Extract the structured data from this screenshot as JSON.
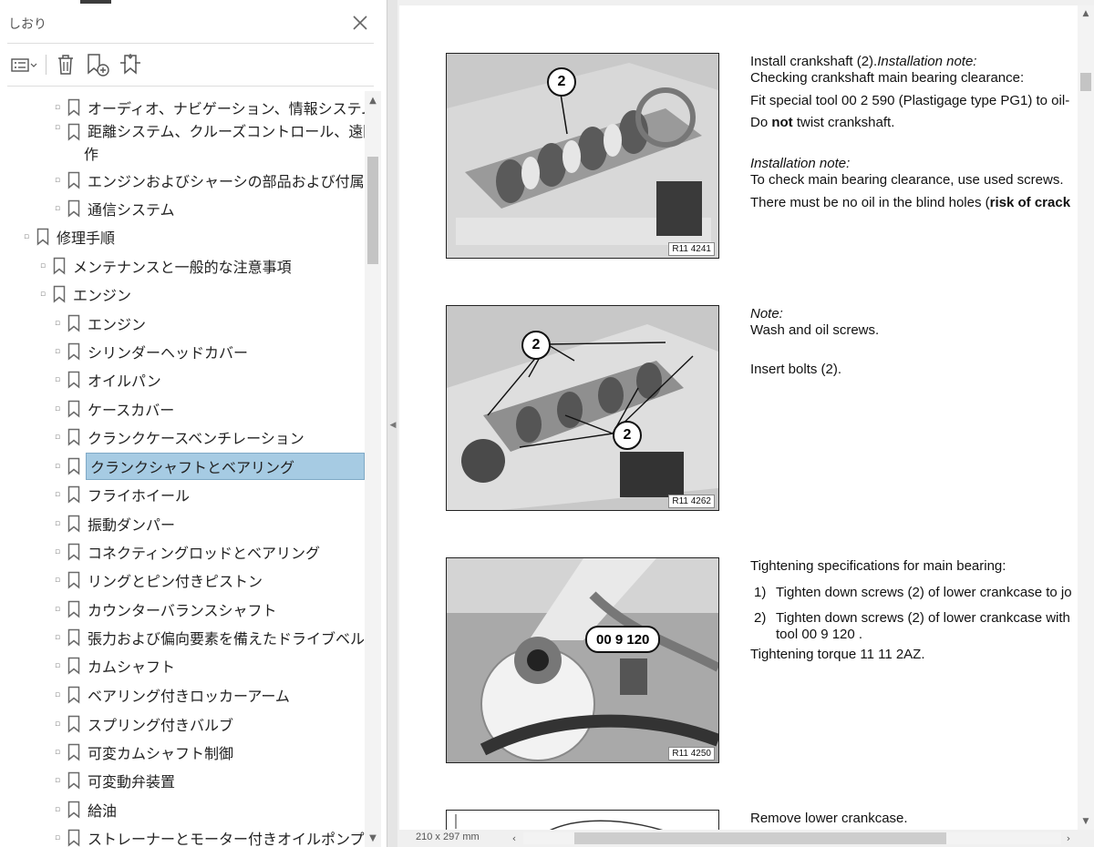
{
  "bookmarks_panel": {
    "title": "しおり",
    "tree": [
      {
        "label": "オーディオ、ナビゲーション、情報システム",
        "level": 2,
        "selected": false
      },
      {
        "label": "距離システム、クルーズコントロール、遠隔操",
        "label2": "作",
        "level": 2,
        "selected": false
      },
      {
        "label": "エンジンおよびシャーシの部品および付属品",
        "level": 2,
        "selected": false
      },
      {
        "label": "通信システム",
        "level": 2,
        "selected": false
      },
      {
        "label": "修理手順",
        "level": 0,
        "selected": false
      },
      {
        "label": "メンテナンスと一般的な注意事項",
        "level": 1,
        "selected": false
      },
      {
        "label": "エンジン",
        "level": 1,
        "selected": false
      },
      {
        "label": "エンジン",
        "level": 2,
        "selected": false
      },
      {
        "label": "シリンダーヘッドカバー",
        "level": 2,
        "selected": false
      },
      {
        "label": "オイルパン",
        "level": 2,
        "selected": false
      },
      {
        "label": "ケースカバー",
        "level": 2,
        "selected": false
      },
      {
        "label": "クランクケースベンチレーション",
        "level": 2,
        "selected": false
      },
      {
        "label": "クランクシャフトとベアリング",
        "level": 2,
        "selected": true
      },
      {
        "label": "フライホイール",
        "level": 2,
        "selected": false
      },
      {
        "label": "振動ダンパー",
        "level": 2,
        "selected": false
      },
      {
        "label": "コネクティングロッドとベアリング",
        "level": 2,
        "selected": false
      },
      {
        "label": "リングとピン付きピストン",
        "level": 2,
        "selected": false
      },
      {
        "label": "カウンターバランスシャフト",
        "level": 2,
        "selected": false
      },
      {
        "label": "張力および偏向要素を備えたドライブベルト",
        "level": 2,
        "selected": false
      },
      {
        "label": "カムシャフト",
        "level": 2,
        "selected": false
      },
      {
        "label": "ベアリング付きロッカーアーム",
        "level": 2,
        "selected": false
      },
      {
        "label": "スプリング付きバルブ",
        "level": 2,
        "selected": false
      },
      {
        "label": "可変カムシャフト制御",
        "level": 2,
        "selected": false
      },
      {
        "label": "可変動弁装置",
        "level": 2,
        "selected": false
      },
      {
        "label": "給油",
        "level": 2,
        "selected": false
      },
      {
        "label": "ストレーナーとモーター付きオイルポンプ",
        "level": 2,
        "selected": false
      }
    ]
  },
  "document": {
    "figures": [
      {
        "code": "R11 4241",
        "callouts": [
          "2"
        ]
      },
      {
        "code": "R11 4262",
        "callouts": [
          "2",
          "2"
        ]
      },
      {
        "code": "R11 4250",
        "callouts": [
          "00 9 120"
        ]
      }
    ],
    "blocks": {
      "b1_l1_a": "Install crankshaft (2).",
      "b1_l1_b": "Installation note:",
      "b1_l2": "Checking crankshaft main bearing clearance:",
      "b1_l3": "Fit special tool 00 2 590 (Plastigage type PG1) to oil-",
      "b1_l4_a": "Do ",
      "b1_l4_b": "not",
      "b1_l4_c": " twist crankshaft.",
      "b1_l5": "Installation note:",
      "b1_l6": "To check main bearing clearance, use used screws.",
      "b1_l7_a": "There must be no oil in the blind holes (",
      "b1_l7_b": "risk of crack",
      "b2_l1": "Note:",
      "b2_l2": "Wash and oil screws.",
      "b2_l3": "Insert bolts (2).",
      "b3_l1": "Tightening specifications for main bearing:",
      "b3_i1_num": "1)",
      "b3_i1": "Tighten down screws (2) of lower crankcase to jo",
      "b3_i2_num": "2)",
      "b3_i2a": "Tighten down screws (2) of lower crankcase with",
      "b3_i2b": "tool 00 9 120 .",
      "b3_l4": "Tightening torque 11 11 2AZ.",
      "b4_l1": "Remove lower crankcase."
    }
  },
  "statusbar": {
    "page_size": "210 x 297 mm"
  }
}
